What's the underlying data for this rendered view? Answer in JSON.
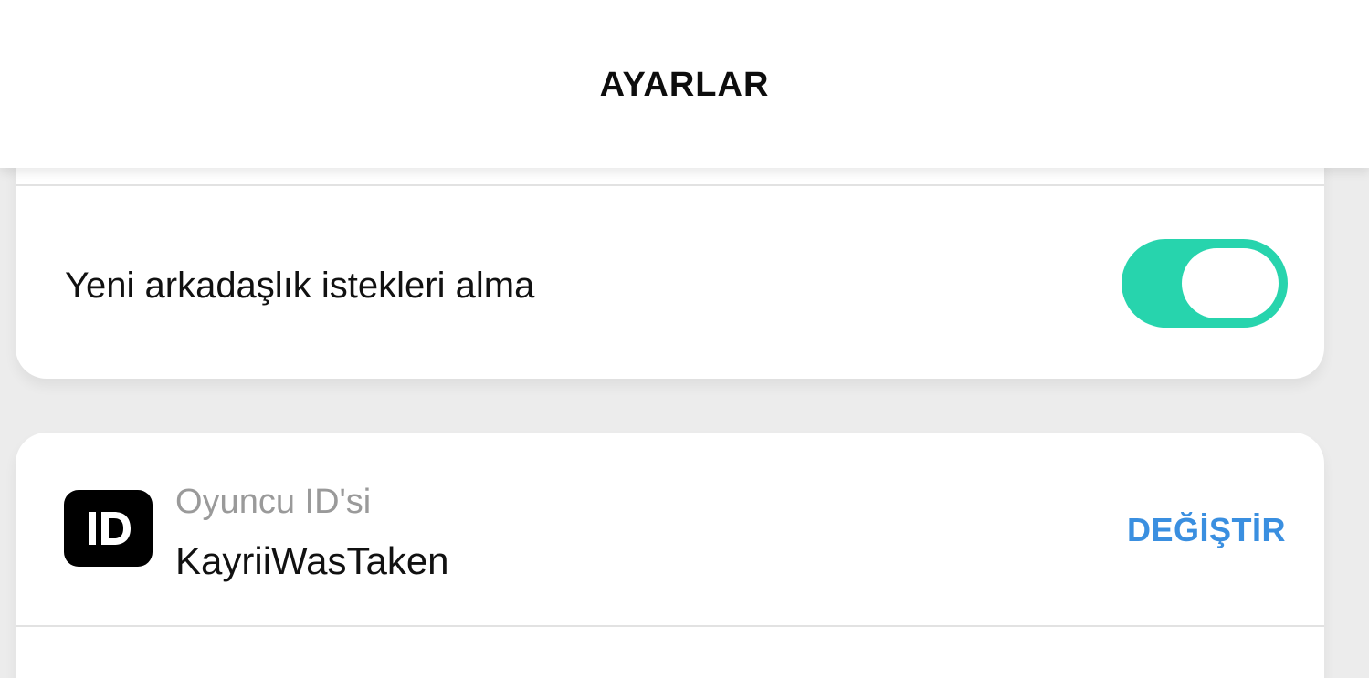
{
  "header": {
    "title": "AYARLAR"
  },
  "friend_requests": {
    "label": "Yeni arkadaşlık istekleri alma",
    "toggle_on": true
  },
  "player_id": {
    "icon": "id-badge-icon",
    "icon_text": "ID",
    "caption": "Oyuncu ID'si",
    "value": "KayriiWasTaken",
    "action_label": "DEĞİŞTİR"
  },
  "colors": {
    "toggle_on": "#27d4ad",
    "action": "#3a8fe0",
    "caption": "#9a9a9a",
    "text": "#111111",
    "background": "#ececec"
  }
}
